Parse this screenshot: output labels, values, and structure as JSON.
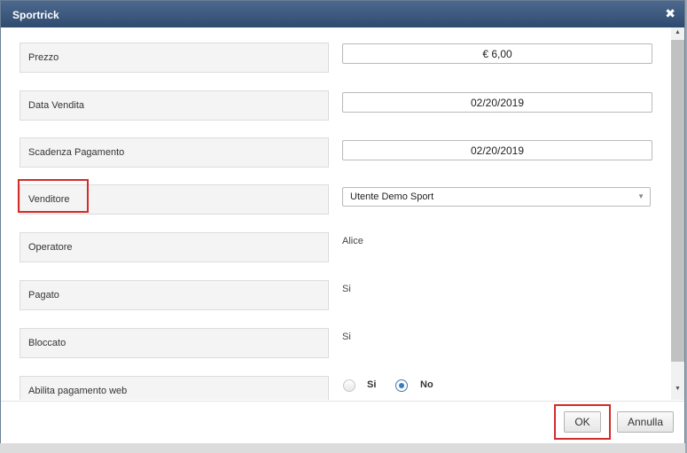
{
  "dialog": {
    "title": "Sportrick",
    "close_glyph": "✖"
  },
  "fields": {
    "prezzo": {
      "label": "Prezzo",
      "value": "€ 6,00"
    },
    "data_vendita": {
      "label": "Data Vendita",
      "value": "02/20/2019"
    },
    "scadenza_pagamento": {
      "label": "Scadenza Pagamento",
      "value": "02/20/2019"
    },
    "venditore": {
      "label": "Venditore",
      "selected": "Utente Demo Sport"
    },
    "operatore": {
      "label": "Operatore",
      "value": "Alice"
    },
    "pagato": {
      "label": "Pagato",
      "value": "Si"
    },
    "bloccato": {
      "label": "Bloccato",
      "value": "Si"
    },
    "abilita_pagamento_web": {
      "label": "Abilita pagamento web",
      "options": [
        "Si",
        "No"
      ],
      "selected": "No"
    }
  },
  "buttons": {
    "ok": "OK",
    "annulla": "Annulla"
  },
  "icons": {
    "select_caret": "▼",
    "scroll_up": "▲",
    "scroll_down": "▼"
  },
  "colors": {
    "titlebar": "#3a577c",
    "highlight": "#d42a2a",
    "radio_selected": "#3d7ab8"
  }
}
